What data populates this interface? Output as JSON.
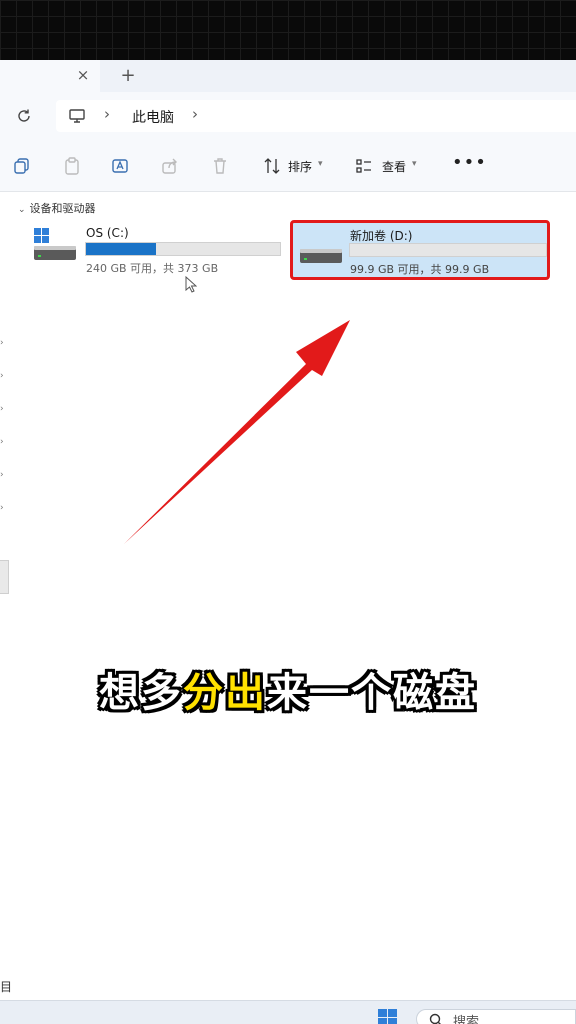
{
  "breadcrumb": {
    "location": "此电脑"
  },
  "tabbar": {
    "close_glyph": "×",
    "new_glyph": "+"
  },
  "toolbar": {
    "sort_label": "排序",
    "view_label": "查看",
    "more_label": "•••"
  },
  "section": {
    "title": "设备和驱动器"
  },
  "drives": [
    {
      "name": "OS (C:)",
      "info": "240 GB 可用，共 373 GB",
      "used_fraction": 0.36,
      "bar_color": "#1a73c7",
      "selected": false
    },
    {
      "name": "新加卷 (D:)",
      "info": "99.9 GB 可用，共 99.9 GB",
      "used_fraction": 0.0,
      "bar_color": "#1a73c7",
      "selected": true
    }
  ],
  "caption": {
    "part1": "想多",
    "part2": "分出",
    "part3": "来一个磁盘"
  },
  "status": {
    "fragment": "目"
  },
  "taskbar": {
    "search_text": "搜索"
  },
  "colors": {
    "highlight_border": "#e21a1a",
    "arrow": "#e21a1a",
    "selected_bg": "#cce4f7",
    "caption_highlight": "#ffe100"
  }
}
